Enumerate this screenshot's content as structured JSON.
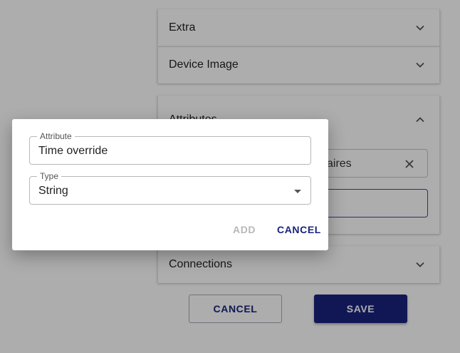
{
  "panels": {
    "extra": {
      "title": "Extra"
    },
    "device_image": {
      "title": "Device Image"
    },
    "attributes": {
      "title": "Attributes",
      "chip_text": "aires"
    },
    "connections": {
      "title": "Connections"
    }
  },
  "form_actions": {
    "cancel_label": "CANCEL",
    "save_label": "SAVE"
  },
  "dialog": {
    "attribute_field": {
      "label": "Attribute",
      "value": "Time override"
    },
    "type_field": {
      "label": "Type",
      "value": "String"
    },
    "add_label": "ADD",
    "cancel_label": "CANCEL"
  },
  "colors": {
    "primary": "#1a237e",
    "disabled": "#b8b8b8",
    "overlay": "rgba(0,0,0,0.32)"
  }
}
